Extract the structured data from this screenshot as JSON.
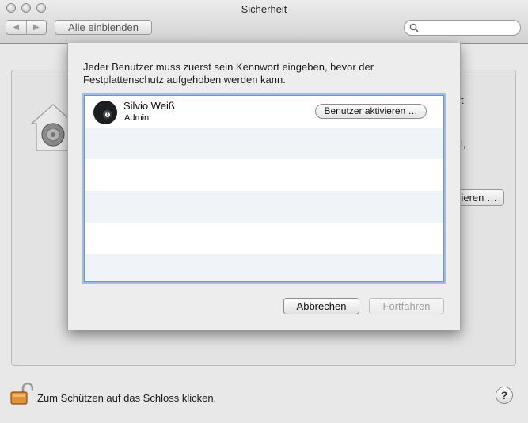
{
  "window": {
    "title": "Sicherheit"
  },
  "toolbar": {
    "back_glyph": "◀",
    "forward_glyph": "▶",
    "show_all_label": "Alle einblenden",
    "search_placeholder": ""
  },
  "background": {
    "partial_texts": [
      "t",
      "l,",
      "vieren …"
    ]
  },
  "sheet": {
    "message": "Jeder Benutzer muss zuerst sein Kennwort eingeben, bevor der Festplattenschutz aufgehoben werden kann.",
    "users": [
      {
        "name": "Silvio Weiß",
        "role": "Admin",
        "action_label": "Benutzer aktivieren …"
      }
    ],
    "cancel_label": "Abbrechen",
    "continue_label": "Fortfahren"
  },
  "footer": {
    "lock_label": "Zum Schützen auf das Schloss klicken.",
    "help_label": "?"
  },
  "colors": {
    "list_focus": "#6e95c6",
    "row_stripe": "#f0f3f7"
  }
}
